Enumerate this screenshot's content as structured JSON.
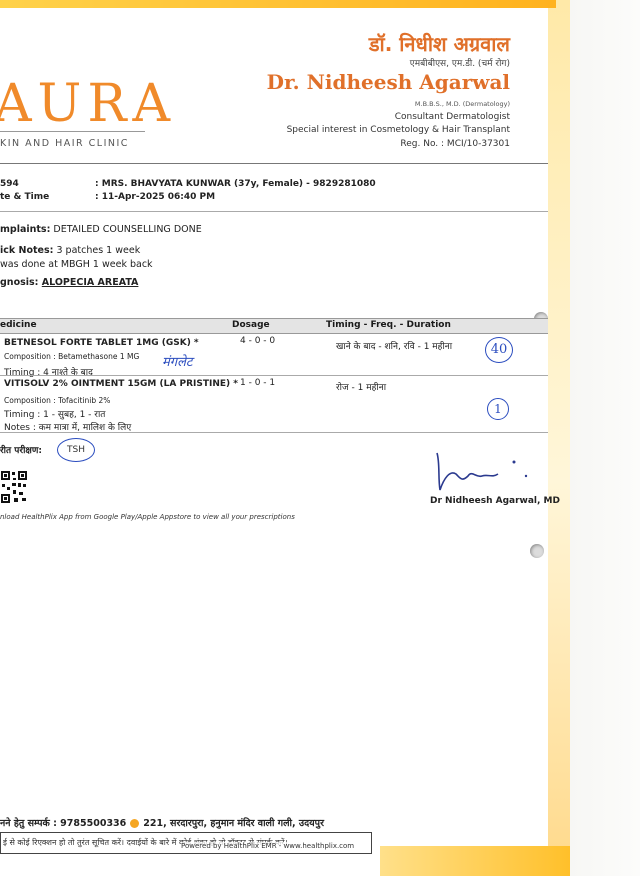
{
  "clinic": {
    "logo": "AURA",
    "tagline": "KIN AND HAIR CLINIC"
  },
  "doctor": {
    "name_hi": "डॉ. निधीश अग्रवाल",
    "degree_hi": "एमबीबीएस, एम.डी. (चर्म रोग)",
    "name_en": "Dr. Nidheesh Agarwal",
    "degree_en": "M.B.B.S., M.D. (Dermatology)",
    "title": "Consultant Dermatologist",
    "interest": "Special interest in Cosmetology & Hair Transplant",
    "reg": "Reg. No. : MCI/10-37301"
  },
  "patient": {
    "id_label": "594",
    "id_value": ": MRS. BHAVYATA KUNWAR (37y, Female) - 9829281080",
    "date_label": "te & Time",
    "date_value": ": 11-Apr-2025 06:40 PM"
  },
  "notes": {
    "complaints_label": "mplaints:",
    "complaints_value": "DETAILED COUNSELLING DONE",
    "quick_label": "ick Notes:",
    "quick_value": "3 patches 1 week",
    "quick_line2": "was done at MBGH 1 week back",
    "diagnosis_label": "gnosis:",
    "diagnosis_value": "ALOPECIA AREATA"
  },
  "table": {
    "headers": {
      "medicine": "edicine",
      "dosage": "Dosage",
      "timing": "Timing - Freq. - Duration"
    },
    "rows": [
      {
        "name": "BETNESOL FORTE TABLET 1MG (GSK) *",
        "composition": "Composition : Betamethasone 1 MG",
        "timing": "Timing :  4 नाश्ते के बाद",
        "dosage": "4 - 0 - 0",
        "freq": "खाने के बाद - शनि, रवि - 1 महीना",
        "handwritten": "मंगलेट",
        "circle": "40"
      },
      {
        "name": "VITISOLV 2% OINTMENT 15GM (LA PRISTINE) *",
        "composition": "Composition : Tofacitinib 2%",
        "timing": "Timing  :   1 - सुबह,  1 - रात",
        "notes": "Notes : कम मात्रा में, मालिश के लिए",
        "dosage": "1 - 0 - 1",
        "freq": "रोज - 1 महीना",
        "circle": "1"
      }
    ]
  },
  "tests": {
    "label": "रीत परीक्षण:",
    "value": "TSH"
  },
  "app_note": "nload HealthPlix App from Google Play/Apple Appstore to view all your prescriptions",
  "signature": "Dr Nidheesh Agarwal, MD",
  "contact": {
    "label": "नने हेतु सम्पर्क : 9785500336",
    "address": "221, सरदारपुरा, हनुमान मंदिर वाली गली, उदयपुर"
  },
  "warning": {
    "text": "ई से कोई रिएक्शन हो तो तुरंत सूचित करें। दवाईयों के बारे में कोई शंका हो तो डॉक्टर से संपर्क करें।",
    "powered": "Powered by HealthPlix EMR - www.healthplix.com"
  }
}
